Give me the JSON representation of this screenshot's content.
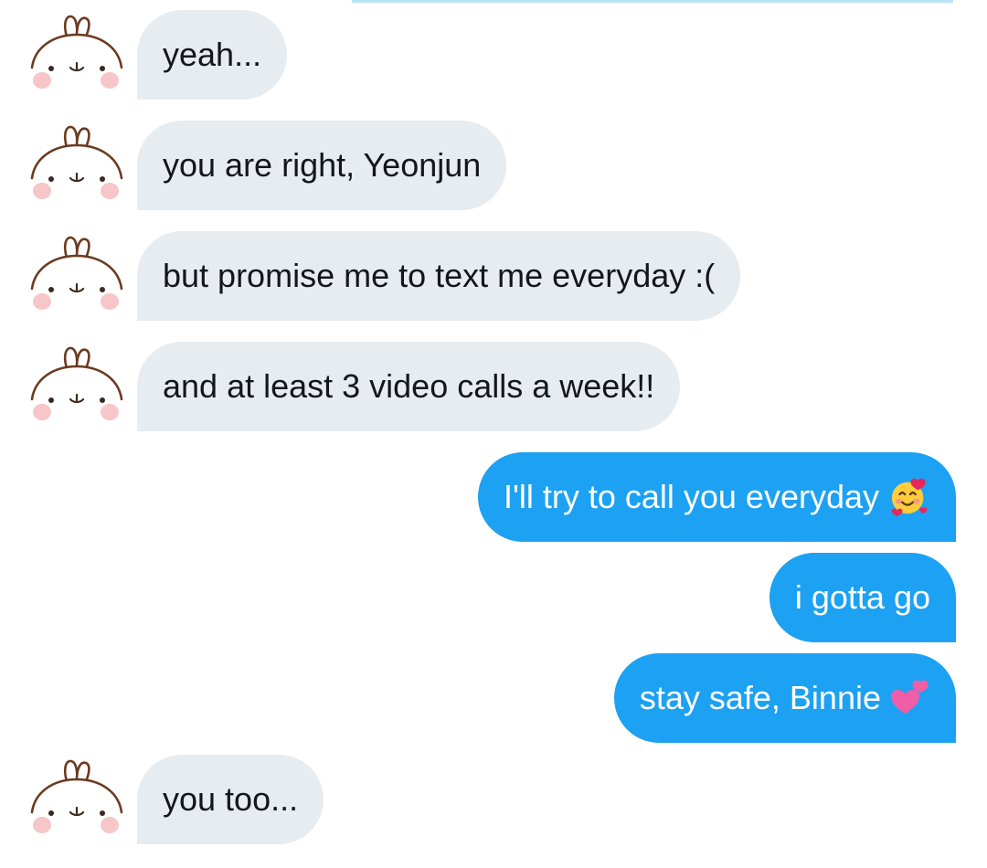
{
  "colors": {
    "received_bubble": "#e6ecf0",
    "sent_bubble": "#1da1f2",
    "received_text": "#14171a",
    "sent_text": "#ffffff"
  },
  "avatar": {
    "icon": "molang-bunny-icon"
  },
  "messages": [
    {
      "direction": "received",
      "text": "yeah..."
    },
    {
      "direction": "received",
      "text": "you are right, Yeonjun"
    },
    {
      "direction": "received",
      "text": "but promise me to text me everyday :("
    },
    {
      "direction": "received",
      "text": "and at least 3 video calls a week!!"
    },
    {
      "direction": "sent",
      "text": "I'll try to call you everyday",
      "emoji": "smiling-face-with-hearts-emoji"
    },
    {
      "direction": "sent",
      "text": "i gotta go"
    },
    {
      "direction": "sent",
      "text": "stay safe, Binnie",
      "emoji": "two-hearts-emoji"
    },
    {
      "direction": "received",
      "text": "you too..."
    }
  ]
}
